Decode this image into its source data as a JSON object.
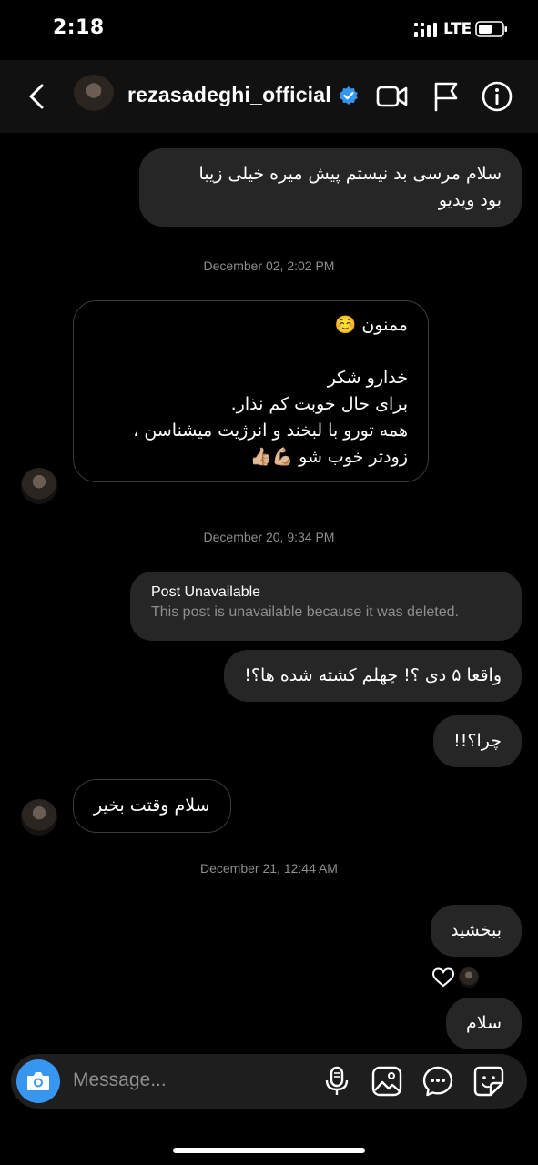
{
  "status_bar": {
    "time": "2:18",
    "network": "LTE"
  },
  "header": {
    "username": "rezasadeghi_official"
  },
  "messages": [
    {
      "direction": "out",
      "text": "سلام مرسی بد نیستم پیش میره خیلی زیبا\nبود ویدیو"
    },
    {
      "type": "timestamp",
      "text": "December 02, 2:02 PM"
    },
    {
      "direction": "in",
      "text": "ممنون ☺️\n\nخدارو شکر\nبرای حال خوبت کم نذار.\nهمه تورو با لبخند و انرژیت میشناسن ،\nزودتر خوب شو 💪🏼👍🏼"
    },
    {
      "type": "timestamp",
      "text": "December 20, 9:34 PM"
    },
    {
      "direction": "out",
      "type": "post_unavailable",
      "title": "Post Unavailable",
      "subtitle": "This post is unavailable because it was deleted."
    },
    {
      "direction": "out",
      "text": "واقعا ۵ دی ؟! چهلم کشته شده ها؟!"
    },
    {
      "direction": "out",
      "text": "چرا؟!!"
    },
    {
      "direction": "in",
      "text": "سلام وقتت بخیر"
    },
    {
      "type": "timestamp",
      "text": "December 21, 12:44 AM"
    },
    {
      "direction": "out",
      "text": "ببخشید",
      "reaction": "heart"
    },
    {
      "direction": "out",
      "text": "سلام"
    }
  ],
  "composer": {
    "placeholder": "Message..."
  },
  "colors": {
    "accent": "#3797f0",
    "bubble": "#262626",
    "timestamp": "#8e8e8e",
    "background": "#000000"
  },
  "icons": [
    "back-icon",
    "verified-icon",
    "video-call-icon",
    "flag-icon",
    "info-icon",
    "camera-icon",
    "microphone-icon",
    "gallery-icon",
    "chat-options-icon",
    "sticker-icon",
    "heart-icon"
  ]
}
